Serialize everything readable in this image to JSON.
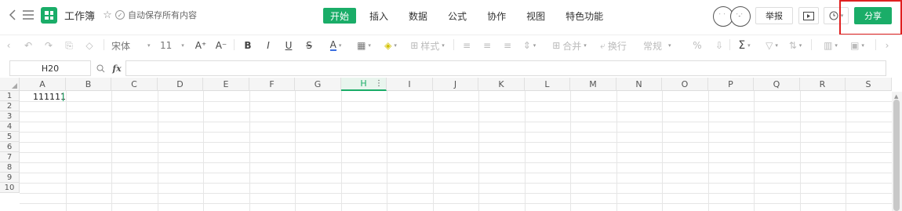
{
  "header": {
    "back_icon": "chevron-left-icon",
    "menu_icon": "hamburger-menu-icon",
    "app_icon": "sheet-logo-icon",
    "title": "工作簿",
    "favorite_icon": "star-icon",
    "save_status_icon": "check-circle-icon",
    "save_status": "自动保存所有内容",
    "tabs": [
      {
        "label": "开始",
        "active": true
      },
      {
        "label": "插入",
        "active": false
      },
      {
        "label": "数据",
        "active": false
      },
      {
        "label": "公式",
        "active": false
      },
      {
        "label": "协作",
        "active": false
      },
      {
        "label": "视图",
        "active": false
      },
      {
        "label": "特色功能",
        "active": false
      }
    ],
    "report_label": "举报",
    "video_icon": "video-icon",
    "history_icon": "clock-icon",
    "share_label": "分享",
    "accent_color": "#1aad68",
    "highlight_color": "#e02020"
  },
  "toolbar": {
    "font_name": "宋体",
    "font_size": "11",
    "increase_font": "A⁺",
    "decrease_font": "A⁻",
    "bold": "B",
    "italic": "I",
    "underline": "U",
    "strike": "S",
    "font_color": "A",
    "style_label": "样式",
    "merge_label": "合并",
    "wrap_label": "换行",
    "format_label": "常规",
    "sum_label": "Σ"
  },
  "formula_bar": {
    "cell_ref": "H20",
    "fx_label": "fx",
    "formula": ""
  },
  "sheet": {
    "columns": [
      "A",
      "B",
      "C",
      "D",
      "E",
      "F",
      "G",
      "H",
      "I",
      "J",
      "K",
      "L",
      "M",
      "N",
      "O",
      "P",
      "Q",
      "R",
      "S"
    ],
    "selected_column": "H",
    "rows": [
      "1",
      "2",
      "3",
      "4",
      "5",
      "6",
      "7",
      "8",
      "9",
      "10"
    ],
    "cell_A1": "111111"
  }
}
